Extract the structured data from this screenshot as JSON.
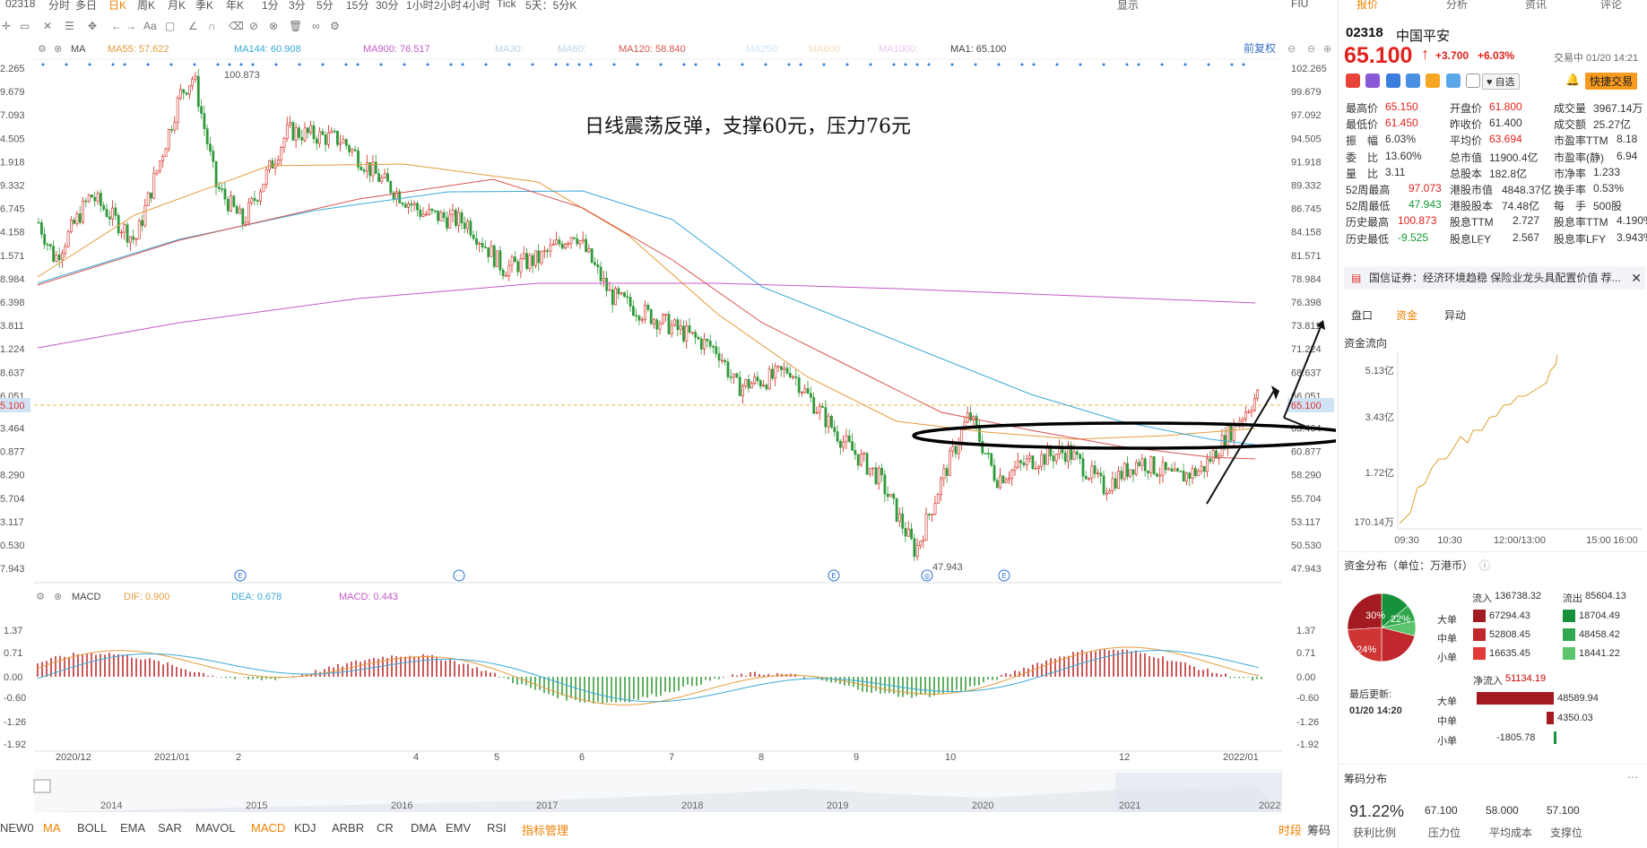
{
  "top_tabs": [
    "02318",
    "分时",
    "多日",
    "日K",
    "周K",
    "月K",
    "季K",
    "年K",
    "1分",
    "3分",
    "5分",
    "15分",
    "30分",
    "1小时",
    "2小时",
    "4小时",
    "Tick",
    "5天：5分K"
  ],
  "top_tabs_active": "日K",
  "top_right": [
    "显示",
    "FIU"
  ],
  "indicators_main": {
    "ma_label": "MA",
    "ma55": "MA55: 57.622",
    "ma144": "MA144: 60.908",
    "ma900": "MA900: 76.517",
    "ma30": "MA30:",
    "ma60": "MA60:",
    "ma120": "MA120: 58.840",
    "ma250": "MA250:",
    "ma600": "MA600:",
    "ma1000": "MA1000:",
    "ma1": "MA1: 65.100",
    "adjust": "前复权"
  },
  "annotation_text": "日线震荡反弹，支撑60元，压力76元",
  "price_labels_left": [
    "2.265",
    "9.679",
    "7.093",
    "4.505",
    "1.918",
    "9.332",
    "6.745",
    "4.158",
    "1.571",
    "8.984",
    "6.398",
    "3.811",
    "1.224",
    "8.637",
    "6.051",
    "5.100",
    "3.464",
    "0.877",
    "8.290",
    "5.704",
    "3.117",
    "0.530",
    "7.943"
  ],
  "price_labels_right": [
    "102.265",
    "99.679",
    "97.092",
    "94.505",
    "91.918",
    "89.332",
    "86.745",
    "84.158",
    "81.571",
    "78.984",
    "76.398",
    "73.811",
    "71.224",
    "68.637",
    "66.051",
    "65.100",
    "63.464",
    "60.877",
    "58.290",
    "55.704",
    "53.117",
    "50.530",
    "47.943"
  ],
  "high_mark": "100.873",
  "low_mark": "47.943",
  "macd_header": {
    "label": "MACD",
    "dif": "DIF: 0.900",
    "dea": "DEA: 0.678",
    "macd": "MACD: 0.443"
  },
  "macd_levels_left": [
    "1.37",
    "0.71",
    "0.00",
    "-0.60",
    "-1.26",
    "-1.92"
  ],
  "macd_levels_right": [
    "1.37",
    "0.71",
    "0.00",
    "-0.60",
    "-1.26",
    "-1.92"
  ],
  "date_axis": [
    "2020/12",
    "2021/01",
    "2",
    "4",
    "5",
    "6",
    "7",
    "8",
    "9",
    "10",
    "12",
    "2022/01"
  ],
  "overview_years": [
    "2014",
    "2015",
    "2016",
    "2017",
    "2018",
    "2019",
    "2020",
    "2021",
    "2022"
  ],
  "bottom_tabs": [
    "NEW0",
    "MA",
    "BOLL",
    "EMA",
    "SAR",
    "MAVOL",
    "MACD",
    "KDJ",
    "ARBR",
    "CR",
    "DMA",
    "EMV",
    "RSI",
    "指标管理"
  ],
  "bottom_active": [
    "MA",
    "MACD"
  ],
  "bottom_right": [
    "时段",
    "筹码"
  ],
  "panel": {
    "tabs": [
      "报价",
      "分析",
      "资讯",
      "评论"
    ],
    "code": "02318",
    "name": "中国平安",
    "price": "65.100",
    "arrow": "↑",
    "change": "+3.700",
    "pct": "+6.03%",
    "trading_status": "交易中 01/20 14:21",
    "watch_label": "自选",
    "quick_trade": "快捷交易",
    "quotes": [
      [
        "最高价",
        "65.150",
        "red",
        "开盘价",
        "61.800",
        "red",
        "成交量",
        "3967.14万",
        ""
      ],
      [
        "最低价",
        "61.450",
        "red",
        "昨收价",
        "61.400",
        "",
        "成交额",
        "25.27亿",
        ""
      ],
      [
        "振　幅",
        "6.03%",
        "",
        "平均价",
        "63.694",
        "red",
        "市盈率TTM",
        "8.18",
        ""
      ],
      [
        "委　比",
        "13.60%",
        "",
        "总市值",
        "11900.4亿",
        "",
        "市盈率(静)",
        "6.94",
        ""
      ],
      [
        "量　比",
        "3.11",
        "",
        "总股本",
        "182.8亿",
        "",
        "市净率",
        "1.233",
        ""
      ],
      [
        "52周最高",
        "97.073",
        "red",
        "港股市值",
        "4848.37亿",
        "",
        "换手率",
        "0.53%",
        ""
      ],
      [
        "52周最低",
        "47.943",
        "green",
        "港股股本",
        "74.48亿",
        "",
        "每　手",
        "500股",
        ""
      ],
      [
        "历史最高",
        "100.873",
        "red",
        "股息TTM",
        "2.727",
        "",
        "股息率TTM",
        "4.190%",
        ""
      ],
      [
        "历史最低",
        "-9.525",
        "green",
        "股息LFY",
        "2.567",
        "",
        "股息率LFY",
        "3.943%",
        ""
      ]
    ],
    "news": "国信证券：经济环境趋稳 保险业龙头具配置价值 荐...",
    "sub_tabs": [
      "盘口",
      "资金",
      "异动"
    ],
    "sub_active": "资金",
    "flow_title": "资金流向",
    "flow_y": [
      "5.13亿",
      "3.43亿",
      "1.72亿",
      "170.14万"
    ],
    "flow_x": [
      "09:30",
      "10:30",
      "12:00/13:00",
      "15:00",
      "16:00"
    ],
    "dist_title": "资金分布（单位：万港币）",
    "inflow_label": "流入",
    "inflow_total": "136738.32",
    "outflow_label": "流出",
    "outflow_total": "85604.13",
    "dist_rows": [
      {
        "label": "大单",
        "in": "67294.43",
        "out": "18704.49"
      },
      {
        "label": "中单",
        "in": "52808.45",
        "out": "48458.42"
      },
      {
        "label": "小单",
        "in": "16635.45",
        "out": "18441.22"
      }
    ],
    "pie_labels": [
      "30%",
      "22%",
      "24%"
    ],
    "net_label": "净流入",
    "net_total": "51134.19",
    "updated_label": "最后更新:",
    "updated_time": "01/20 14:20",
    "net_rows": [
      {
        "label": "大单",
        "value": "48589.94",
        "frac": 1.0
      },
      {
        "label": "中单",
        "value": "4350.03",
        "frac": 0.09
      },
      {
        "label": "小单",
        "value": "-1805.78",
        "frac": 0.04
      }
    ],
    "chip_title": "筹码分布",
    "chip_values": [
      {
        "v": "91.22%",
        "l": "获利比例"
      },
      {
        "v": "67.100",
        "l": "压力位"
      },
      {
        "v": "58.000",
        "l": "平均成本"
      },
      {
        "v": "57.100",
        "l": "支撑位"
      }
    ]
  },
  "colors": {
    "up": "#d4231a",
    "down": "#2f9a3a",
    "ma55": "#e69b3c",
    "ma144": "#3aa9d9",
    "ma120": "#d9534f",
    "ma900": "#c45ac8",
    "accent": "#f08000"
  }
}
